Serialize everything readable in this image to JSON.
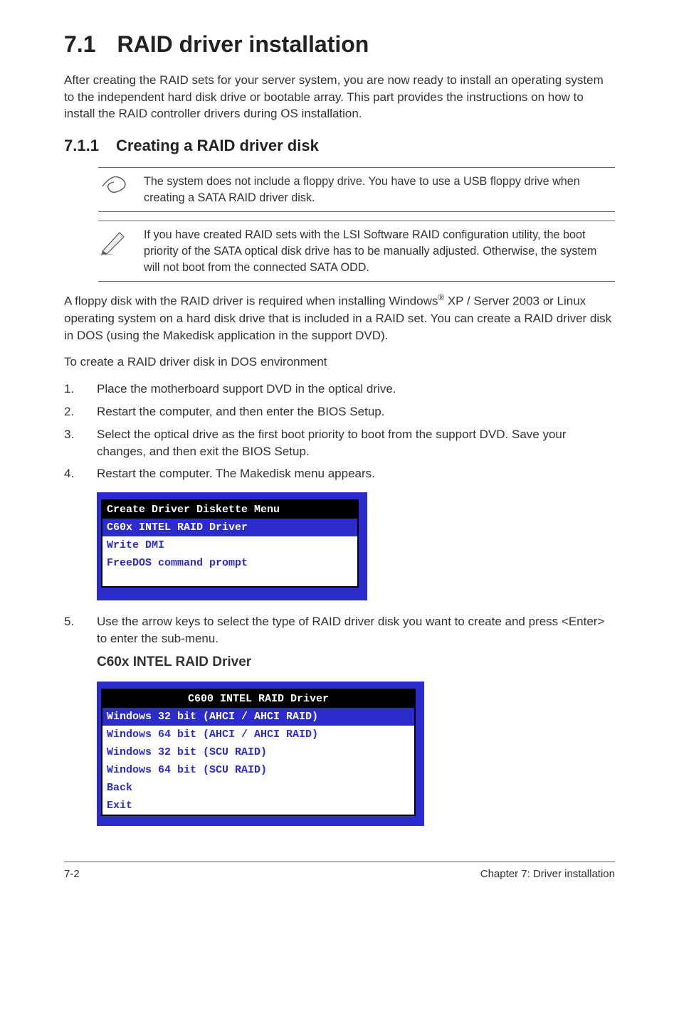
{
  "heading": {
    "num": "7.1",
    "title": "RAID driver installation"
  },
  "intro": "After creating the RAID sets for your server system, you are now ready to install an operating system to the independent hard disk drive or bootable array. This part provides the instructions on how to install the RAID controller drivers during OS installation.",
  "subheading": {
    "num": "7.1.1",
    "title": "Creating a RAID driver disk"
  },
  "note1": "The system does not include a floppy drive. You have to use a USB floppy drive when creating a SATA RAID driver disk.",
  "note2": "If you have created RAID sets with the LSI Software RAID configuration utility, the boot priority of the SATA optical disk drive has to be manually adjusted. Otherwise, the system will not boot from the connected SATA ODD.",
  "para1_a": "A floppy disk with the RAID driver is required when installing Windows",
  "para1_b": " XP / Server 2003 or Linux operating system on a hard disk drive that is included in a RAID set. You can create a RAID driver disk in DOS (using the Makedisk application in the support DVD).",
  "para2": "To create a RAID driver disk in DOS environment",
  "steps": [
    {
      "n": "1.",
      "t": "Place the motherboard support DVD in the optical drive."
    },
    {
      "n": "2.",
      "t": "Restart the computer, and then enter the BIOS Setup."
    },
    {
      "n": "3.",
      "t": "Select the optical drive as the first boot priority to boot from the support DVD. Save your changes, and then exit the BIOS Setup."
    },
    {
      "n": "4.",
      "t": "Restart the computer. The Makedisk menu appears."
    }
  ],
  "menu1": {
    "title": "Create Driver Diskette Menu",
    "selected": "C60x INTEL RAID Driver",
    "items": [
      "Write DMI",
      "FreeDOS command prompt"
    ]
  },
  "step5": {
    "n": "5.",
    "t": "Use the arrow keys to select the type of RAID driver disk you want to create and press <Enter> to enter the sub-menu."
  },
  "subhead2": "C60x INTEL RAID Driver",
  "menu2": {
    "title": "C600 INTEL RAID Driver",
    "selected": "Windows 32 bit (AHCI / AHCI RAID)",
    "items": [
      "Windows 64 bit (AHCI / AHCI RAID)",
      "Windows 32 bit (SCU RAID)",
      "Windows 64 bit (SCU RAID)",
      "Back",
      "Exit"
    ]
  },
  "footer": {
    "left": "7-2",
    "right": "Chapter 7: Driver installation"
  }
}
